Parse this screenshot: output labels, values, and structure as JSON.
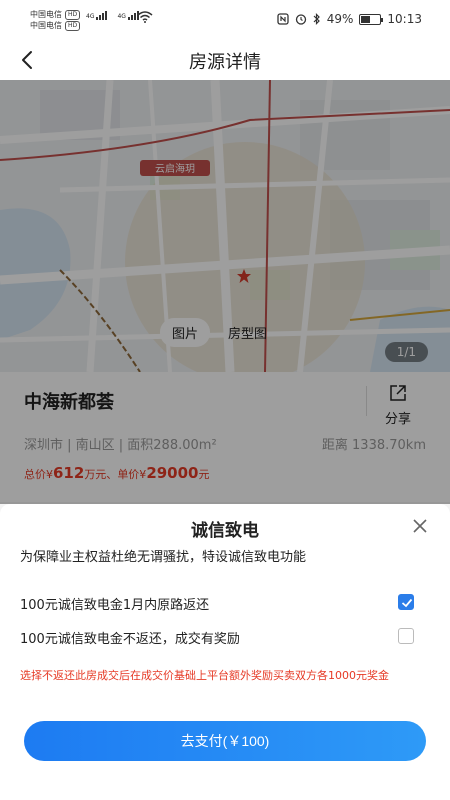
{
  "status_bar": {
    "carrier1": "中国电信",
    "carrier2": "中国电信",
    "hd": "HD",
    "net": "4G",
    "battery": "49%",
    "battery_level": 0.49,
    "time": "10:13"
  },
  "header": {
    "title": "房源详情"
  },
  "map": {
    "tabs": [
      "图片",
      "房型图"
    ],
    "active_tab": 0,
    "counter": "1/1",
    "poi_label": "云启海玥"
  },
  "info": {
    "name": "中海新都荟",
    "share_label": "分享",
    "meta": "深圳市 | 南山区 | 面积288.00m²",
    "distance": "距离 1338.70km",
    "price_prefix": "总价¥",
    "total": "612",
    "total_unit": "万元、",
    "unit_prefix": "单价¥",
    "unit_price": "29000",
    "unit_unit": "元"
  },
  "sheet": {
    "title": "诚信致电",
    "subtitle": "为保障业主权益杜绝无谓骚扰，特设诚信致电功能",
    "options": [
      {
        "label": "100元诚信致电金1月内原路返还",
        "checked": true
      },
      {
        "label": "100元诚信致电金不返还，成交有奖励",
        "checked": false
      }
    ],
    "note": "选择不返还此房成交后在成交价基础上平台额外奖励买卖双方各1000元奖金",
    "pay_label": "去支付(￥100)"
  },
  "colors": {
    "accent": "#2b7de9",
    "price_red": "#e63a26"
  },
  "icons": [
    "back-arrow-icon",
    "share-icon",
    "close-icon",
    "check-icon",
    "map-marker-icon",
    "wifi-icon",
    "battery-icon"
  ]
}
